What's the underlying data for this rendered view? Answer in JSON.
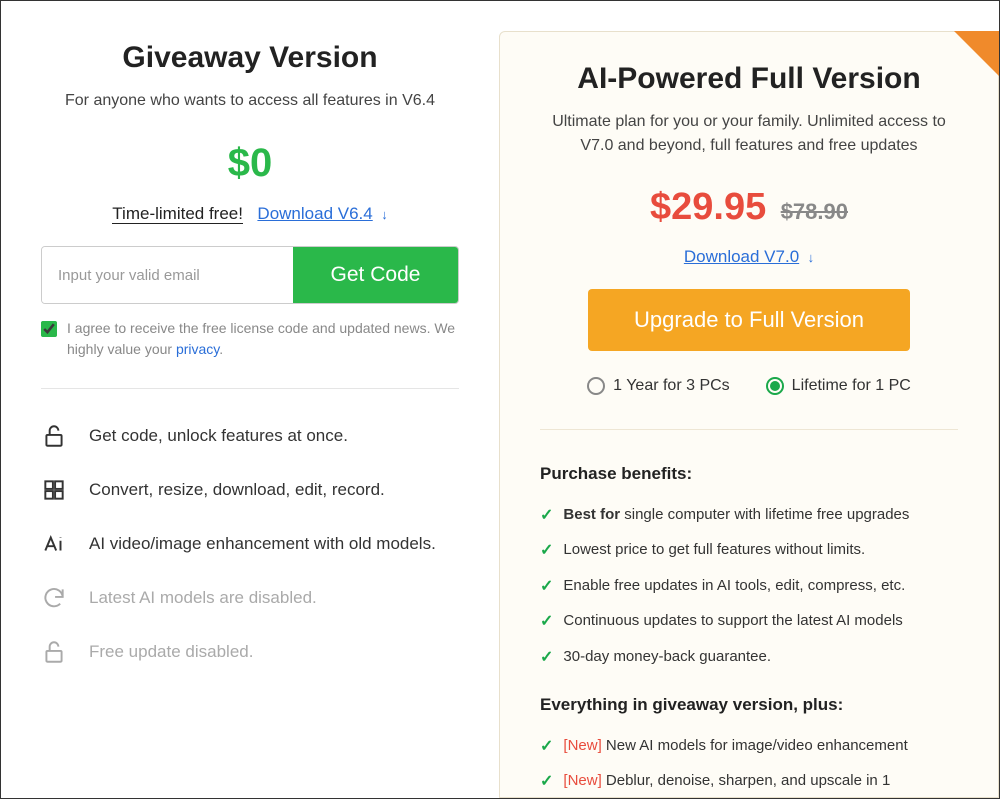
{
  "left": {
    "title": "Giveaway Version",
    "subtitle": "For anyone who wants to access all features in V6.4",
    "price": "$0",
    "time_limited": "Time-limited free!",
    "download_label": "Download V6.4",
    "email_placeholder": "Input your valid email",
    "get_code": "Get Code",
    "agree_text_a": "I agree to receive the free license code and updated news. We highly value your ",
    "privacy": "privacy",
    "agree_text_b": ".",
    "features": [
      {
        "text": "Get code, unlock features at once.",
        "disabled": false,
        "icon": "unlock"
      },
      {
        "text": "Convert, resize, download, edit, record.",
        "disabled": false,
        "icon": "grid"
      },
      {
        "text": "AI video/image enhancement with old models.",
        "disabled": false,
        "icon": "ai"
      },
      {
        "text": "Latest AI models are disabled.",
        "disabled": true,
        "icon": "refresh"
      },
      {
        "text": "Free update disabled.",
        "disabled": true,
        "icon": "unlock"
      }
    ]
  },
  "right": {
    "title": "AI-Powered Full Version",
    "subtitle": "Ultimate plan for you or your family. Unlimited access to V7.0 and beyond, full features and free updates",
    "price": "$29.95",
    "price_old": "$78.90",
    "download_label": "Download V7.0",
    "upgrade": "Upgrade to Full Version",
    "radio1": "1 Year for 3 PCs",
    "radio2": "Lifetime for 1 PC",
    "benefits_title": "Purchase benefits:",
    "benefits": [
      {
        "bold": "Best for",
        "text": " single computer with lifetime free upgrades"
      },
      {
        "text": "Lowest price to get full features without limits."
      },
      {
        "text": "Enable free updates in AI tools, edit, compress, etc."
      },
      {
        "text": "Continuous updates to support the latest AI models"
      },
      {
        "text": "30-day money-back guarantee."
      }
    ],
    "plus_title": "Everything in giveaway version, plus:",
    "plus": [
      {
        "new": "[New]",
        "text": " New AI models for image/video enhancement"
      },
      {
        "new": "[New]",
        "text": " Deblur, denoise, sharpen, and upscale in 1"
      }
    ]
  }
}
